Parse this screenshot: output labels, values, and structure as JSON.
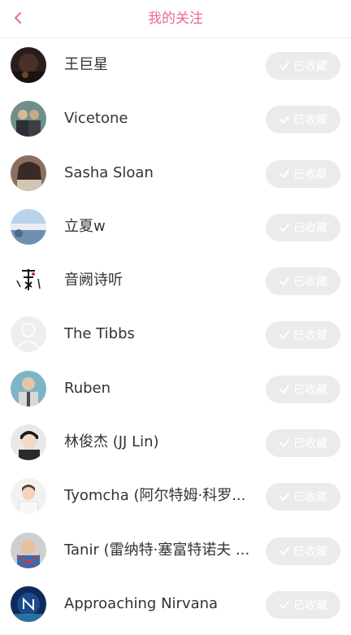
{
  "header": {
    "title": "我的关注",
    "back_icon": "chevron-left-icon",
    "accent_color": "#e96a8d"
  },
  "button_label": "已收藏",
  "artists": [
    {
      "name": "王巨星"
    },
    {
      "name": "Vicetone"
    },
    {
      "name": "Sasha Sloan"
    },
    {
      "name": "立夏w"
    },
    {
      "name": "音阙诗听"
    },
    {
      "name": "The Tibbs"
    },
    {
      "name": "Ruben"
    },
    {
      "name": "林俊杰 (JJ Lin)"
    },
    {
      "name": "Tyomcha (阿尔特姆·科罗..."
    },
    {
      "name": "Tanir (雷纳特·塞富特诺夫 ..."
    },
    {
      "name": "Approaching Nirvana"
    }
  ]
}
